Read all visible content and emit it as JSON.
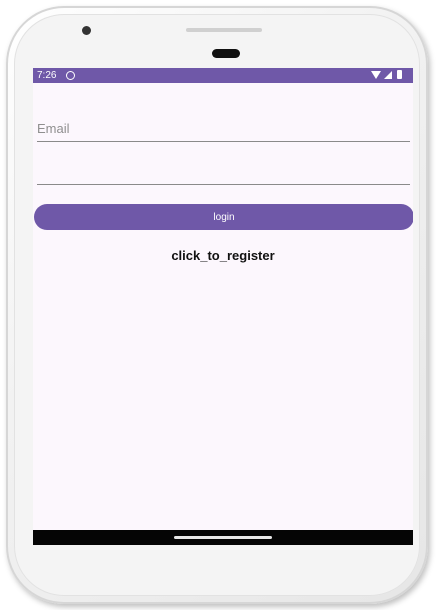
{
  "status_bar": {
    "time": "7:26",
    "background_color": "#6f58a8",
    "icons": [
      "sync-icon",
      "wifi-icon",
      "signal-icon",
      "battery-icon"
    ]
  },
  "form": {
    "email": {
      "placeholder": "Email",
      "value": ""
    },
    "password": {
      "placeholder": "",
      "value": ""
    },
    "login_label": "login",
    "register_label": "click_to_register"
  },
  "colors": {
    "accent": "#6f58a8",
    "screen_background": "#fcf7fd",
    "nav_bar": "#050505"
  }
}
